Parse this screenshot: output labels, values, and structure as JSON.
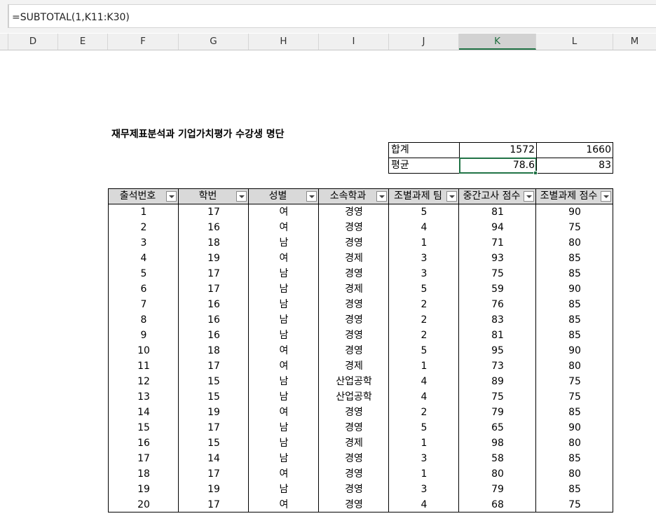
{
  "formula_bar": {
    "formula": "=SUBTOTAL(1,K11:K30)"
  },
  "column_headers": [
    "D",
    "E",
    "F",
    "G",
    "H",
    "I",
    "J",
    "K",
    "L",
    "M"
  ],
  "active_column": "K",
  "sheet": {
    "title": "재무제표분석과 기업가치평가 수강생 명단",
    "summary": {
      "sum_label": "합계",
      "sum_k": "1572",
      "sum_l": "1660",
      "avg_label": "평균",
      "avg_k": "78.6",
      "avg_l": "83"
    },
    "table": {
      "headers": [
        "출석번호",
        "학번",
        "성별",
        "소속학과",
        "조별과제 팀",
        "중간고사 점수",
        "조별과제 점수"
      ],
      "rows": [
        [
          "1",
          "17",
          "여",
          "경영",
          "5",
          "81",
          "90"
        ],
        [
          "2",
          "16",
          "여",
          "경영",
          "4",
          "94",
          "75"
        ],
        [
          "3",
          "18",
          "남",
          "경영",
          "1",
          "71",
          "80"
        ],
        [
          "4",
          "19",
          "여",
          "경제",
          "3",
          "93",
          "85"
        ],
        [
          "5",
          "17",
          "남",
          "경영",
          "3",
          "75",
          "85"
        ],
        [
          "6",
          "17",
          "남",
          "경제",
          "5",
          "59",
          "90"
        ],
        [
          "7",
          "16",
          "남",
          "경영",
          "2",
          "76",
          "85"
        ],
        [
          "8",
          "16",
          "남",
          "경영",
          "2",
          "83",
          "85"
        ],
        [
          "9",
          "16",
          "남",
          "경영",
          "2",
          "81",
          "85"
        ],
        [
          "10",
          "18",
          "여",
          "경영",
          "5",
          "95",
          "90"
        ],
        [
          "11",
          "17",
          "여",
          "경제",
          "1",
          "73",
          "80"
        ],
        [
          "12",
          "15",
          "남",
          "산업공학",
          "4",
          "89",
          "75"
        ],
        [
          "13",
          "15",
          "남",
          "산업공학",
          "4",
          "75",
          "75"
        ],
        [
          "14",
          "19",
          "여",
          "경영",
          "2",
          "79",
          "85"
        ],
        [
          "15",
          "17",
          "남",
          "경영",
          "5",
          "65",
          "90"
        ],
        [
          "16",
          "15",
          "남",
          "경제",
          "1",
          "98",
          "80"
        ],
        [
          "17",
          "14",
          "남",
          "경영",
          "3",
          "58",
          "85"
        ],
        [
          "18",
          "17",
          "여",
          "경영",
          "1",
          "80",
          "80"
        ],
        [
          "19",
          "19",
          "남",
          "경영",
          "3",
          "79",
          "85"
        ],
        [
          "20",
          "17",
          "여",
          "경영",
          "4",
          "68",
          "75"
        ]
      ]
    }
  }
}
